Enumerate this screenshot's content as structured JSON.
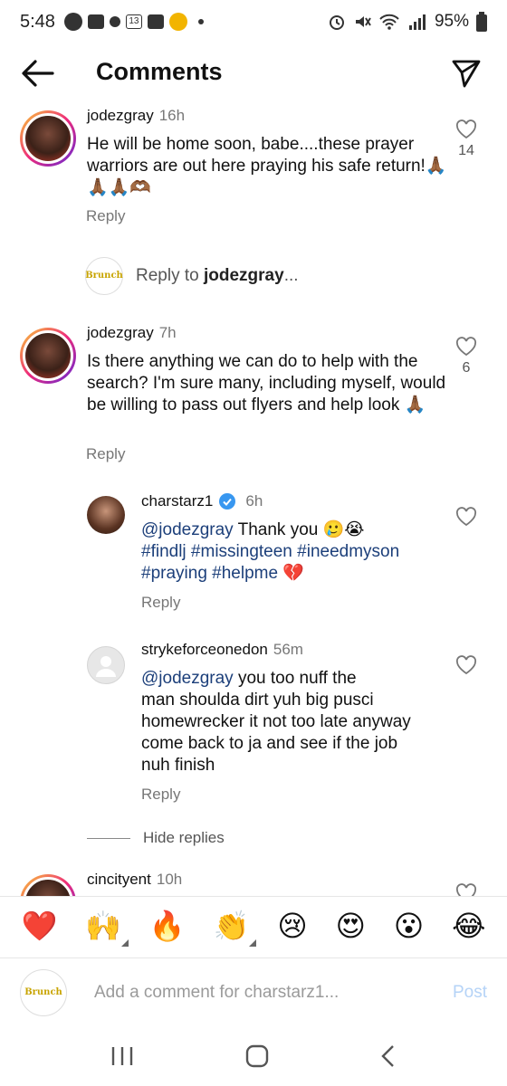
{
  "status": {
    "time": "5:48",
    "notif_badge": "13",
    "battery": "95%"
  },
  "header": {
    "title": "Comments"
  },
  "comments": [
    {
      "username": "jodezgray",
      "time": "16h",
      "text": "He will be home soon, babe....these prayer warriors are out here praying his safe return!🙏🏾🙏🏾🙏🏾🫶🏾",
      "likes": "14",
      "reply_label": "Reply"
    },
    {
      "username": "jodezgray",
      "time": "7h",
      "text": "Is there anything we can do to help with the search? I'm sure many, including myself, would be willing to pass out flyers and help look 🙏🏾",
      "likes": "6",
      "reply_label": "Reply"
    }
  ],
  "reply_to": {
    "prefix": "Reply to ",
    "username": "jodezgray",
    "suffix": "...",
    "logo_text": "Brunch"
  },
  "replies": [
    {
      "username": "charstarz1",
      "verified": true,
      "time": "6h",
      "mention": "@jodezgray",
      "text_part1": " Thank you 🥲😭",
      "tags_line1": "#findlj #missingteen #ineedmyson",
      "tags_line2": "#praying #helpme",
      "emoji_end": " 💔",
      "reply_label": "Reply"
    },
    {
      "username": "strykeforceonedon",
      "time": "56m",
      "mention": "@jodezgray",
      "line1": " you too nuff the",
      "line2": "man shoulda dirt yuh big pusci",
      "line3": "homewrecker it not too late anyway",
      "line4": "come back to ja and see if the job",
      "line5": "nuh finish",
      "reply_label": "Reply"
    }
  ],
  "hide_replies": "Hide replies",
  "partial_comment": {
    "username": "cincityent",
    "time": "10h"
  },
  "emoji_bar": [
    "❤️",
    "🙌",
    "🔥",
    "👏",
    "😢",
    "😍",
    "😮",
    "😂"
  ],
  "input": {
    "placeholder": "Add a comment for charstarz1...",
    "post_label": "Post"
  },
  "colors": {
    "link": "#1c3f7a",
    "verified": "#3897f0",
    "post_disabled": "#b5d3f7"
  }
}
